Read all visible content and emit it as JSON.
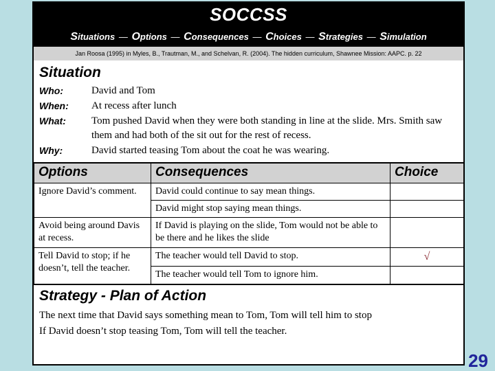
{
  "slide": {
    "background_color": "#b9dee3",
    "page_number": "29"
  },
  "header": {
    "title": "SOCCSS",
    "subtitle_parts": [
      {
        "cap": "S",
        "rest": "ituations"
      },
      {
        "cap": "O",
        "rest": "ptions"
      },
      {
        "cap": "C",
        "rest": "onsequences"
      },
      {
        "cap": "C",
        "rest": "hoices"
      },
      {
        "cap": "S",
        "rest": "trategies"
      },
      {
        "cap": "S",
        "rest": "imulation"
      }
    ],
    "separator": "—",
    "background_color": "#000000",
    "text_color": "#ffffff"
  },
  "citation": {
    "text": "Jan Roosa (1995) in Myles, B., Trautman, M., and Schelvan, R. (2004). The hidden curriculum, Shawnee Mission: AAPC. p. 22",
    "background_color": "#d2d2d2"
  },
  "situation": {
    "heading": "Situation",
    "rows": [
      {
        "label": "Who:",
        "value": "David and Tom"
      },
      {
        "label": "When:",
        "value": "At recess after lunch"
      },
      {
        "label": "What:",
        "value": "Tom pushed David when they were both standing in line at the slide.  Mrs. Smith saw them and had both of the sit out for the rest of recess."
      },
      {
        "label": "Why:",
        "value": "David started teasing Tom about the coat he was wearing."
      }
    ]
  },
  "options_table": {
    "headers": {
      "options": "Options",
      "consequences": "Consequences",
      "choice": "Choice"
    },
    "header_background": "#d2d2d2",
    "check_color": "#8b2b33",
    "rows": [
      {
        "option": "Ignore David’s comment.",
        "consequences": [
          {
            "text": "David could continue to say mean things.",
            "choice": ""
          },
          {
            "text": "David might stop saying mean things.",
            "choice": ""
          }
        ]
      },
      {
        "option": "Avoid being around Davis at recess.",
        "consequences": [
          {
            "text": "If David is playing on the slide, Tom would not be able to be there and he likes the slide",
            "choice": ""
          }
        ]
      },
      {
        "option": "Tell David to stop; if he doesn’t, tell the teacher.",
        "consequences": [
          {
            "text": "The teacher would tell David to stop.",
            "choice": "√"
          },
          {
            "text": "The teacher would tell Tom to ignore him.",
            "choice": ""
          }
        ]
      }
    ]
  },
  "strategy": {
    "heading": "Strategy - Plan of Action",
    "lines": [
      "The next time that David says something mean to Tom, Tom will tell him to stop",
      "If David doesn’t stop teasing Tom, Tom will tell the teacher."
    ]
  }
}
